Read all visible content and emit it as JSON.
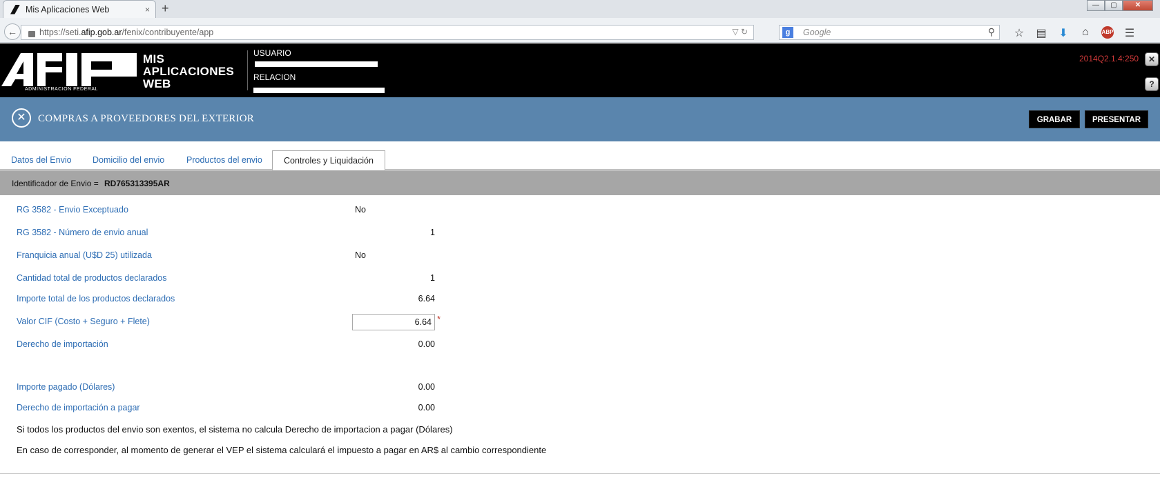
{
  "browser": {
    "tab_title": "Mis Aplicaciones Web",
    "tab_close": "×",
    "new_tab": "+",
    "url_prefix": "https://seti.",
    "url_domain": "afip.gob.ar",
    "url_suffix": "/fenix/contribuyente/app",
    "search_placeholder": "Google",
    "search_engine_letter": "g",
    "window_controls": [
      "—",
      "▢",
      "✕"
    ],
    "icons": [
      "star-icon",
      "bookmarks-icon",
      "download-icon",
      "home-icon",
      "adblock-icon",
      "menu-icon"
    ],
    "abp_label": "ABP"
  },
  "header": {
    "logo_text": "AFIP",
    "logo_subtitle": "ADMINISTRACION FEDERAL",
    "app_title_line1": "MIS",
    "app_title_line2": "APLICACIONES",
    "app_title_line3": "WEB",
    "usuario_label": "USUARIO",
    "relacion_label": "RELACION",
    "version": "2014Q2.1.4:250",
    "close_btn": "✕",
    "help_btn": "?"
  },
  "page": {
    "title": "COMPRAS A PROVEEDORES DEL EXTERIOR",
    "close_icon": "✕",
    "grabar_label": "GRABAR",
    "presentar_label": "PRESENTAR"
  },
  "tabs": [
    {
      "label": "Datos del Envio",
      "active": false
    },
    {
      "label": "Domicilio del envio",
      "active": false
    },
    {
      "label": "Productos del envio",
      "active": false
    },
    {
      "label": "Controles y Liquidación",
      "active": true
    }
  ],
  "identifier": {
    "label": "Identificador de Envio =",
    "value": "RD765313395AR"
  },
  "fields": {
    "envio_exceptuado": {
      "label": "RG 3582 - Envio Exceptuado",
      "value": "No"
    },
    "numero_envio_anual": {
      "label": "RG 3582 - Número de envio anual",
      "value": "1"
    },
    "franquicia": {
      "label": "Franquicia anual (U$D 25) utilizada",
      "value": "No"
    },
    "cantidad_productos": {
      "label": "Cantidad total de productos declarados",
      "value": "1"
    },
    "importe_productos": {
      "label": "Importe total de los productos declarados",
      "value": "6.64"
    },
    "valor_cif": {
      "label": "Valor CIF (Costo + Seguro + Flete)",
      "value": "6.64",
      "required_mark": "*"
    },
    "derecho_importacion": {
      "label": "Derecho de importación",
      "value": "0.00"
    },
    "importe_pagado": {
      "label": "Importe pagado (Dólares)",
      "value": "0.00"
    },
    "derecho_a_pagar": {
      "label": "Derecho de importación a pagar",
      "value": "0.00"
    }
  },
  "notes": {
    "note1": "Si todos los productos del envio son exentos, el sistema no calcula Derecho de importacion a pagar (Dólares)",
    "note2": "En caso de corresponder, al momento de generar el VEP el sistema calculará el impuesto a pagar en AR$ al cambio correspondiente"
  },
  "colors": {
    "band": "#5a85ad",
    "link_blue": "#2d6db4",
    "version_red": "#d23a3a",
    "id_bar": "#a6a6a6"
  }
}
